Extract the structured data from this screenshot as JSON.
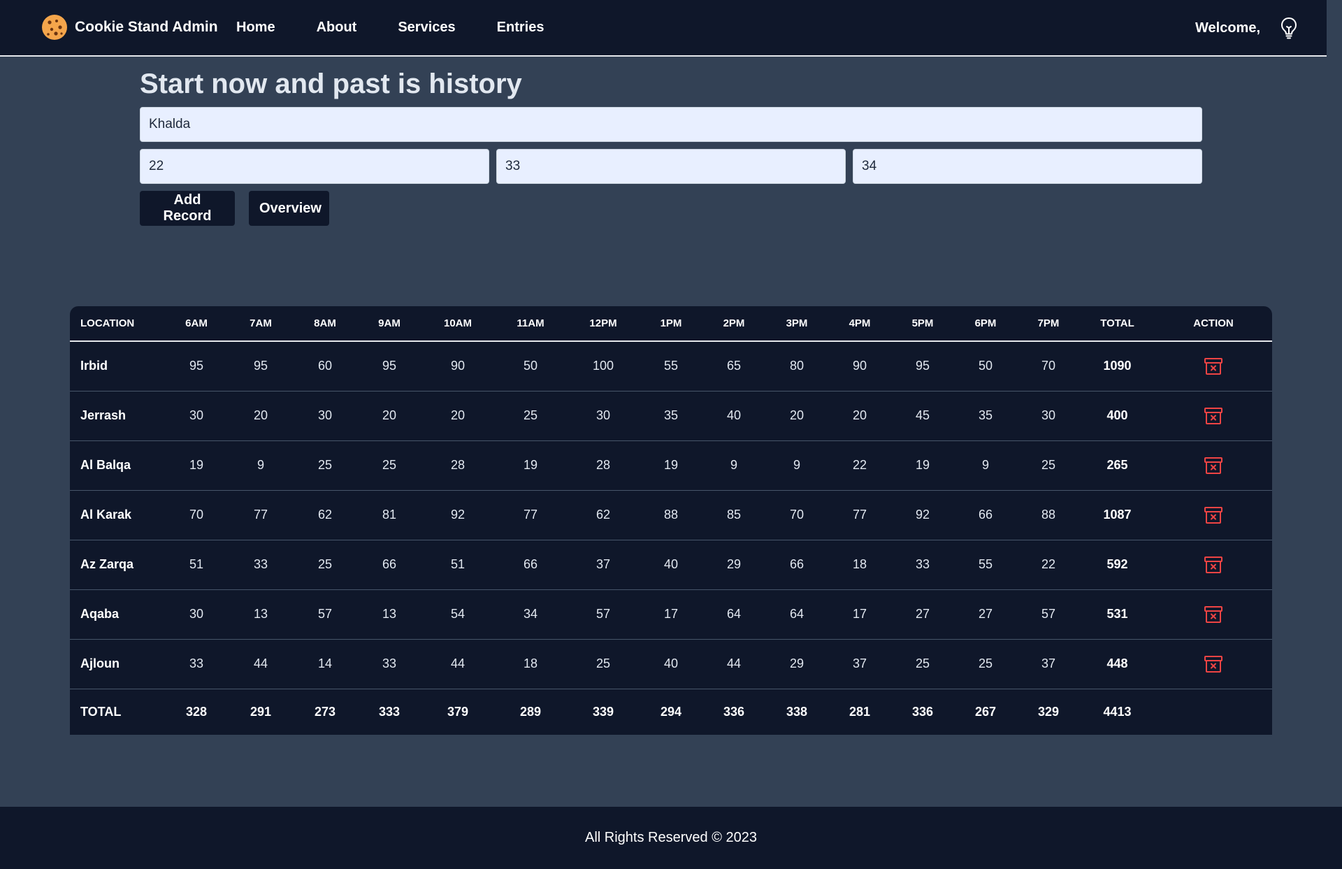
{
  "nav": {
    "brand": "Cookie Stand Admin",
    "links": [
      "Home",
      "About",
      "Services",
      "Entries"
    ],
    "welcome": "Welcome,",
    "logo_icon": "cookie-icon",
    "theme_icon": "lightbulb-icon"
  },
  "form": {
    "heading": "Start now and past is history",
    "location_value": "Khalda",
    "min_value": "22",
    "max_value": "33",
    "avg_value": "34",
    "add_label": "Add Record",
    "overview_label": "Overview"
  },
  "table": {
    "headers": [
      "LOCATION",
      "6AM",
      "7AM",
      "8AM",
      "9AM",
      "10AM",
      "11AM",
      "12PM",
      "1PM",
      "2PM",
      "3PM",
      "4PM",
      "5PM",
      "6PM",
      "7PM",
      "TOTAL",
      "ACTION"
    ],
    "rows": [
      {
        "location": "Irbid",
        "hours": [
          95,
          95,
          60,
          95,
          90,
          50,
          100,
          55,
          65,
          80,
          90,
          95,
          50,
          70
        ],
        "total": 1090
      },
      {
        "location": "Jerrash",
        "hours": [
          30,
          20,
          30,
          20,
          20,
          25,
          30,
          35,
          40,
          20,
          20,
          45,
          35,
          30
        ],
        "total": 400
      },
      {
        "location": "Al Balqa",
        "hours": [
          19,
          9,
          25,
          25,
          28,
          19,
          28,
          19,
          9,
          9,
          22,
          19,
          9,
          25
        ],
        "total": 265
      },
      {
        "location": "Al Karak",
        "hours": [
          70,
          77,
          62,
          81,
          92,
          77,
          62,
          88,
          85,
          70,
          77,
          92,
          66,
          88
        ],
        "total": 1087
      },
      {
        "location": "Az Zarqa",
        "hours": [
          51,
          33,
          25,
          66,
          51,
          66,
          37,
          40,
          29,
          66,
          18,
          33,
          55,
          22
        ],
        "total": 592
      },
      {
        "location": "Aqaba",
        "hours": [
          30,
          13,
          57,
          13,
          54,
          34,
          57,
          17,
          64,
          64,
          17,
          27,
          27,
          57
        ],
        "total": 531
      },
      {
        "location": "Ajloun",
        "hours": [
          33,
          44,
          14,
          33,
          44,
          18,
          25,
          40,
          44,
          29,
          37,
          25,
          25,
          37
        ],
        "total": 448
      }
    ],
    "footer_label": "TOTAL",
    "footer_hours": [
      328,
      291,
      273,
      333,
      379,
      289,
      339,
      294,
      336,
      338,
      281,
      336,
      267,
      329
    ],
    "footer_total": 4413,
    "delete_icon": "trash-icon",
    "delete_color": "#ef4444"
  },
  "footer": {
    "text": "All Rights Reserved © 2023"
  }
}
